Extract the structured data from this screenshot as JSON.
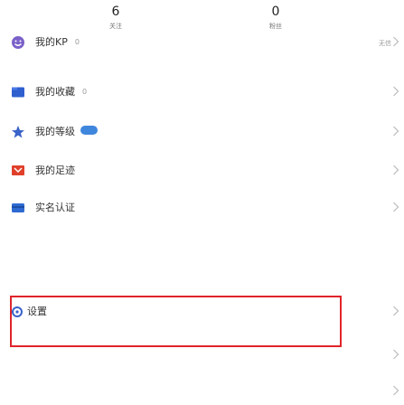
{
  "stats": [
    {
      "value": "6",
      "label": "关注"
    },
    {
      "value": "0",
      "label": "粉丝"
    }
  ],
  "menu": [
    {
      "label": "我的KP",
      "count": "0",
      "extra": "无信",
      "icon": "smile-icon"
    },
    {
      "label": "我的收藏",
      "count": "0",
      "icon": "folder-icon"
    },
    {
      "label": "我的等级",
      "icon": "star-icon"
    },
    {
      "label": "我的足迹",
      "icon": "flag-icon"
    },
    {
      "label": "实名认证",
      "icon": "card-icon"
    },
    {
      "label": "设置",
      "icon": "gear-icon"
    }
  ],
  "colors": {
    "accent": "#3f86dd",
    "kp": "#7b61c9",
    "folder": "#2f5fcf",
    "star": "#3a63c8",
    "flag": "#e0402a",
    "card": "#2e6ad1",
    "highlight": "#e0242a"
  }
}
